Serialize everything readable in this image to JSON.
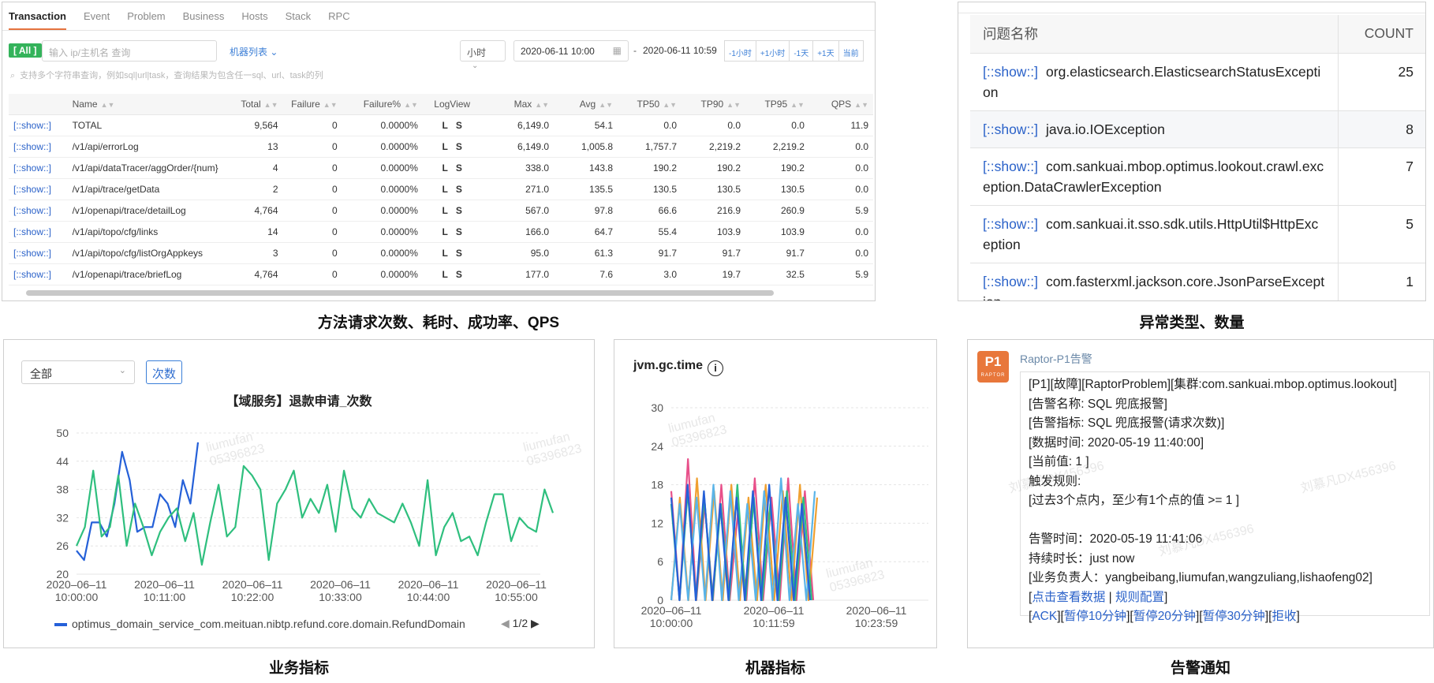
{
  "transaction": {
    "tabs": [
      "Transaction",
      "Event",
      "Problem",
      "Business",
      "Hosts",
      "Stack",
      "RPC"
    ],
    "all_badge": "[ All ]",
    "ip_placeholder": "输入 ip/主机名 查询",
    "machine_list": "机器列表 ⌄",
    "unit": "小时",
    "date_start": "2020-06-11 10:00",
    "date_sep": "-",
    "date_end": "2020-06-11 10:59",
    "range_buttons": [
      "-1小时",
      "+1小时",
      "-1天",
      "+1天",
      "当前"
    ],
    "search_hint": "支持多个字符串查询，例如sql|url|task，查询结果为包含任一sql、url、task的列",
    "columns": [
      "Name",
      "Total",
      "Failure",
      "Failure%",
      "LogView",
      "Max",
      "Avg",
      "TP50",
      "TP90",
      "TP95",
      "QPS"
    ],
    "rows": [
      {
        "link": "[::show::]",
        "name": "TOTAL",
        "total": "9,564",
        "failure": "0",
        "failure_pct": "0.0000%",
        "l": "L",
        "s": "S",
        "max": "6,149.0",
        "avg": "54.1",
        "tp50": "0.0",
        "tp90": "0.0",
        "tp95": "0.0",
        "qps": "11.9"
      },
      {
        "link": "[::show::]",
        "name": "/v1/api/errorLog",
        "total": "13",
        "failure": "0",
        "failure_pct": "0.0000%",
        "l": "L",
        "s": "S",
        "max": "6,149.0",
        "avg": "1,005.8",
        "tp50": "1,757.7",
        "tp90": "2,219.2",
        "tp95": "2,219.2",
        "qps": "0.0"
      },
      {
        "link": "[::show::]",
        "name": "/v1/api/dataTracer/aggOrder/{num}",
        "total": "4",
        "failure": "0",
        "failure_pct": "0.0000%",
        "l": "L",
        "s": "S",
        "max": "338.0",
        "avg": "143.8",
        "tp50": "190.2",
        "tp90": "190.2",
        "tp95": "190.2",
        "qps": "0.0"
      },
      {
        "link": "[::show::]",
        "name": "/v1/api/trace/getData",
        "total": "2",
        "failure": "0",
        "failure_pct": "0.0000%",
        "l": "L",
        "s": "S",
        "max": "271.0",
        "avg": "135.5",
        "tp50": "130.5",
        "tp90": "130.5",
        "tp95": "130.5",
        "qps": "0.0"
      },
      {
        "link": "[::show::]",
        "name": "/v1/openapi/trace/detailLog",
        "total": "4,764",
        "failure": "0",
        "failure_pct": "0.0000%",
        "l": "L",
        "s": "S",
        "max": "567.0",
        "avg": "97.8",
        "tp50": "66.6",
        "tp90": "216.9",
        "tp95": "260.9",
        "qps": "5.9"
      },
      {
        "link": "[::show::]",
        "name": "/v1/api/topo/cfg/links",
        "total": "14",
        "failure": "0",
        "failure_pct": "0.0000%",
        "l": "L",
        "s": "S",
        "max": "166.0",
        "avg": "64.7",
        "tp50": "55.4",
        "tp90": "103.9",
        "tp95": "103.9",
        "qps": "0.0"
      },
      {
        "link": "[::show::]",
        "name": "/v1/api/topo/cfg/listOrgAppkeys",
        "total": "3",
        "failure": "0",
        "failure_pct": "0.0000%",
        "l": "L",
        "s": "S",
        "max": "95.0",
        "avg": "61.3",
        "tp50": "91.7",
        "tp90": "91.7",
        "tp95": "91.7",
        "qps": "0.0"
      },
      {
        "link": "[::show::]",
        "name": "/v1/openapi/trace/briefLog",
        "total": "4,764",
        "failure": "0",
        "failure_pct": "0.0000%",
        "l": "L",
        "s": "S",
        "max": "177.0",
        "avg": "7.6",
        "tp50": "3.0",
        "tp90": "19.7",
        "tp95": "32.5",
        "qps": "5.9"
      }
    ],
    "caption": "方法请求次数、耗时、成功率、QPS"
  },
  "exceptions": {
    "col_name": "问题名称",
    "col_count": "COUNT",
    "rows": [
      {
        "link": "[::show::]",
        "name": "org.elasticsearch.ElasticsearchStatusException",
        "count": "25"
      },
      {
        "link": "[::show::]",
        "name": "java.io.IOException",
        "count": "8"
      },
      {
        "link": "[::show::]",
        "name": "com.sankuai.mbop.optimus.lookout.crawl.exception.DataCrawlerException",
        "count": "7"
      },
      {
        "link": "[::show::]",
        "name": "com.sankuai.it.sso.sdk.utils.HttpUtil$HttpException",
        "count": "5"
      },
      {
        "link": "[::show::]",
        "name": "com.fasterxml.jackson.core.JsonParseException",
        "count": "1"
      }
    ],
    "caption": "异常类型、数量"
  },
  "business": {
    "select_value": "全部",
    "count_button": "次数",
    "legend_label": "optimus_domain_service_com.meituan.nibtp.refund.core.domain.RefundDomain",
    "pager": "1/2",
    "caption": "业务指标"
  },
  "machine": {
    "title": "jvm.gc.time",
    "info_icon": "i",
    "caption": "机器指标"
  },
  "alert": {
    "logo_text": "P1",
    "logo_sub": "RAPTOR",
    "sender": "Raptor-P1告警",
    "lines": [
      "[P1][故障][RaptorProblem][集群:com.sankuai.mbop.optimus.lookout]",
      "[告警名称: SQL 兜底报警]",
      "[告警指标: SQL 兜底报警(请求次数)]",
      "[数据时间: 2020-05-19 11:40:00]",
      "[当前值: 1 ]",
      "触发规则:",
      "[过去3个点内，至少有1个点的值 >= 1 ]",
      "",
      "告警时间：2020-05-19 11:41:06",
      "持续时长：just now",
      "[业务负责人：yangbeibang,liumufan,wangzuliang,lishaofeng02]"
    ],
    "links_row1": {
      "pre": "[",
      "a": "点击查看数据",
      "sep": " | ",
      "b": "规则配置",
      "post": "]"
    },
    "links_row2": [
      "ACK",
      "暂停10分钟",
      "暂停20分钟",
      "暂停30分钟",
      "拒收"
    ],
    "caption": "告警通知"
  },
  "chart_data": [
    {
      "type": "line",
      "title": "【域服务】退款申请_次数",
      "xlabel": "",
      "ylabel": "",
      "ylim": [
        20,
        50
      ],
      "yticks": [
        20,
        26,
        32,
        38,
        44,
        50
      ],
      "xticks": [
        "2020–06–11\n10:00:00",
        "2020–06–11\n10:11:00",
        "2020–06–11\n10:22:00",
        "2020–06–11\n10:33:00",
        "2020–06–11\n10:44:00",
        "2020–06–11\n10:55:00"
      ],
      "x_minutes_range": [
        0,
        59
      ],
      "grid": true,
      "legend": "bottom",
      "colors": {
        "blue": "#2560d8",
        "green": "#2fbf7e"
      },
      "series": [
        {
          "name": "optimus_domain_service_com.meituan.nibtp.refund.core.domain.RefundDomain",
          "color": "#2560d8",
          "values": [
            25,
            23,
            31,
            31,
            28,
            35,
            46,
            40,
            29,
            30,
            30,
            37,
            35,
            30,
            40,
            35,
            48
          ]
        },
        {
          "color": "#2fbf7e",
          "values": [
            26,
            30,
            42,
            28,
            30,
            41,
            26,
            35,
            30,
            24,
            29,
            32,
            34,
            27,
            33,
            22,
            31,
            39,
            28,
            30,
            43,
            41,
            38,
            23,
            35,
            38,
            42,
            32,
            36,
            33,
            39,
            29,
            42,
            34,
            32,
            36,
            33,
            32,
            31,
            35,
            31,
            26,
            40,
            24,
            30,
            33,
            27,
            28,
            24,
            31,
            37,
            37,
            27,
            32,
            30,
            29,
            38,
            33
          ]
        }
      ]
    },
    {
      "type": "line",
      "title": "jvm.gc.time",
      "ylim": [
        0,
        30
      ],
      "yticks": [
        0,
        6,
        12,
        18,
        24,
        30
      ],
      "xticks": [
        "2020–06–11\n10:00:00",
        "2020–06–11\n10:11:59",
        "2020–06–11\n10:23:59"
      ],
      "x_minutes_range": [
        0,
        24
      ],
      "grid": true,
      "series": [
        {
          "color": "#e8508a",
          "values": [
            17,
            0,
            22,
            0,
            15,
            0,
            18,
            0,
            14,
            0,
            19,
            0,
            16,
            0,
            19,
            0,
            17,
            0
          ]
        },
        {
          "color": "#f0a030",
          "values": [
            0,
            16,
            0,
            19,
            0,
            17,
            0,
            18,
            0,
            16,
            0,
            18,
            0,
            17,
            0,
            18,
            0,
            16
          ]
        },
        {
          "color": "#2fbf7e",
          "values": [
            15,
            0,
            17,
            0,
            16,
            0,
            15,
            0,
            18,
            0,
            16,
            0,
            15,
            0,
            17,
            0,
            16,
            0
          ]
        },
        {
          "color": "#5ab4e8",
          "values": [
            0,
            15,
            0,
            16,
            0,
            18,
            0,
            17,
            0,
            15,
            0,
            17,
            0,
            19,
            0,
            15,
            0,
            17
          ]
        },
        {
          "color": "#2560d8",
          "values": [
            16,
            0,
            18,
            0,
            17,
            0,
            15,
            0,
            16,
            0,
            17,
            0,
            18,
            0,
            16,
            0,
            15,
            0
          ]
        }
      ]
    }
  ]
}
